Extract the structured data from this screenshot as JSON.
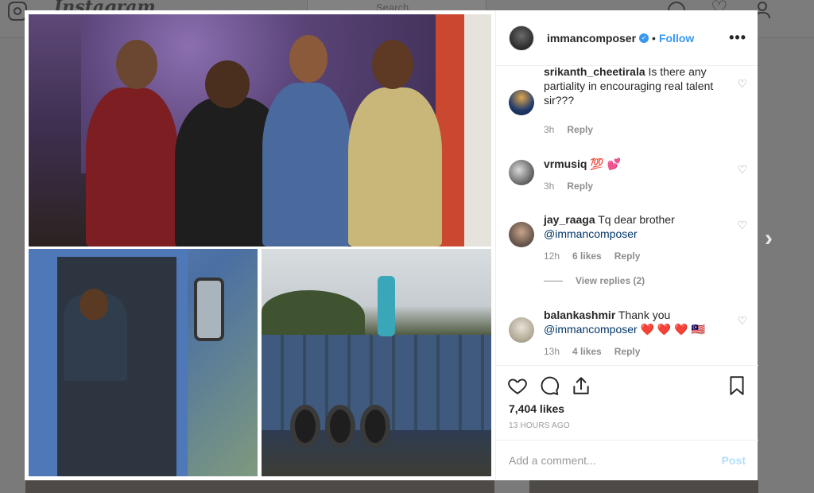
{
  "background": {
    "wordmark": "Instagram",
    "search_placeholder": "Search"
  },
  "post": {
    "owner": "immancomposer",
    "follow_label": "Follow",
    "separator": "•",
    "verified_glyph": "✓",
    "more_label": "•••"
  },
  "comments": [
    {
      "user": "srikanth_cheetirala",
      "text": " Is there any partiality in encouraging real talent sir???",
      "time": "3h",
      "likes": "",
      "reply": "Reply"
    },
    {
      "user": "vrmusiq",
      "text": " 💯 💕",
      "time": "3h",
      "likes": "",
      "reply": "Reply"
    },
    {
      "user": "jay_raaga",
      "text": " Tq dear brother ",
      "mention": "@immancomposer",
      "time": "12h",
      "likes": "6 likes",
      "reply": "Reply"
    },
    {
      "user": "balankashmir",
      "text": " Thank you ",
      "mention": "@immancomposer",
      "suffix": " ❤️ ❤️ ❤️ 🇲🇾",
      "time": "13h",
      "likes": "4 likes",
      "reply": "Reply"
    }
  ],
  "view_replies": "View replies (2)",
  "stats": {
    "likes": "7,404 likes",
    "time_ago": "13 HOURS AGO"
  },
  "add_comment": {
    "placeholder": "Add a comment...",
    "post_label": "Post"
  },
  "icons": {
    "nav": [
      "compass-icon",
      "heart-icon",
      "profile-icon"
    ],
    "actions": [
      "like-icon",
      "comment-icon",
      "share-icon",
      "bookmark-icon"
    ]
  },
  "colors": {
    "link": "#3897f0",
    "verified": "#3897f0",
    "post_disabled": "#b2dffc",
    "meta": "#8e8e8e"
  }
}
